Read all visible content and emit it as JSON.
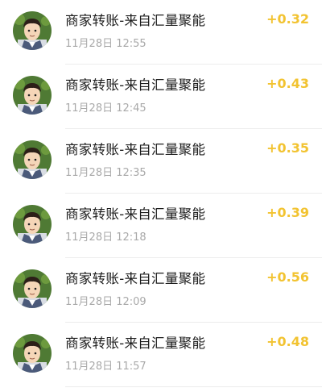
{
  "transactions": [
    {
      "title": "商家转账-来自汇量聚能",
      "time": "11月28日 12:55",
      "amount": "+0.32"
    },
    {
      "title": "商家转账-来自汇量聚能",
      "time": "11月28日 12:45",
      "amount": "+0.43"
    },
    {
      "title": "商家转账-来自汇量聚能",
      "time": "11月28日 12:35",
      "amount": "+0.35"
    },
    {
      "title": "商家转账-来自汇量聚能",
      "time": "11月28日 12:18",
      "amount": "+0.39"
    },
    {
      "title": "商家转账-来自汇量聚能",
      "time": "11月28日 12:09",
      "amount": "+0.56"
    },
    {
      "title": "商家转账-来自汇量聚能",
      "time": "11月28日 11:57",
      "amount": "+0.48"
    }
  ],
  "colors": {
    "amount": "#f2c331",
    "title": "#1c1c1c",
    "time": "#a9a9a9",
    "divider": "#ececec"
  },
  "avatar_icon": "cartoon-man-avatar-icon"
}
